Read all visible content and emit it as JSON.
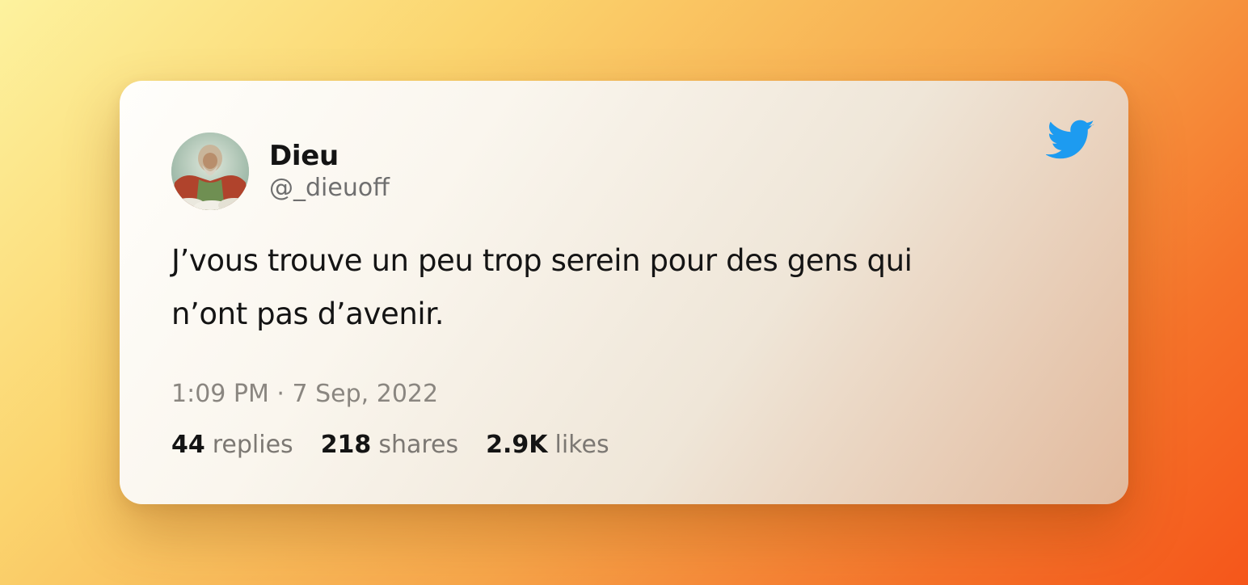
{
  "tweet": {
    "author": {
      "display_name": "Dieu",
      "handle": "@_dieuoff"
    },
    "text_line_1": "J’vous trouve un peu trop serein pour des gens qui",
    "text_line_2": "n’ont pas d’avenir.",
    "timestamp": "1:09 PM · 7 Sep, 2022",
    "stats": {
      "replies_count": "44",
      "replies_label": "replies",
      "shares_count": "218",
      "shares_label": "shares",
      "likes_count": "2.9K",
      "likes_label": "likes"
    },
    "platform_icon": "twitter-bird-icon",
    "accent_color": "#1d9bf0"
  }
}
